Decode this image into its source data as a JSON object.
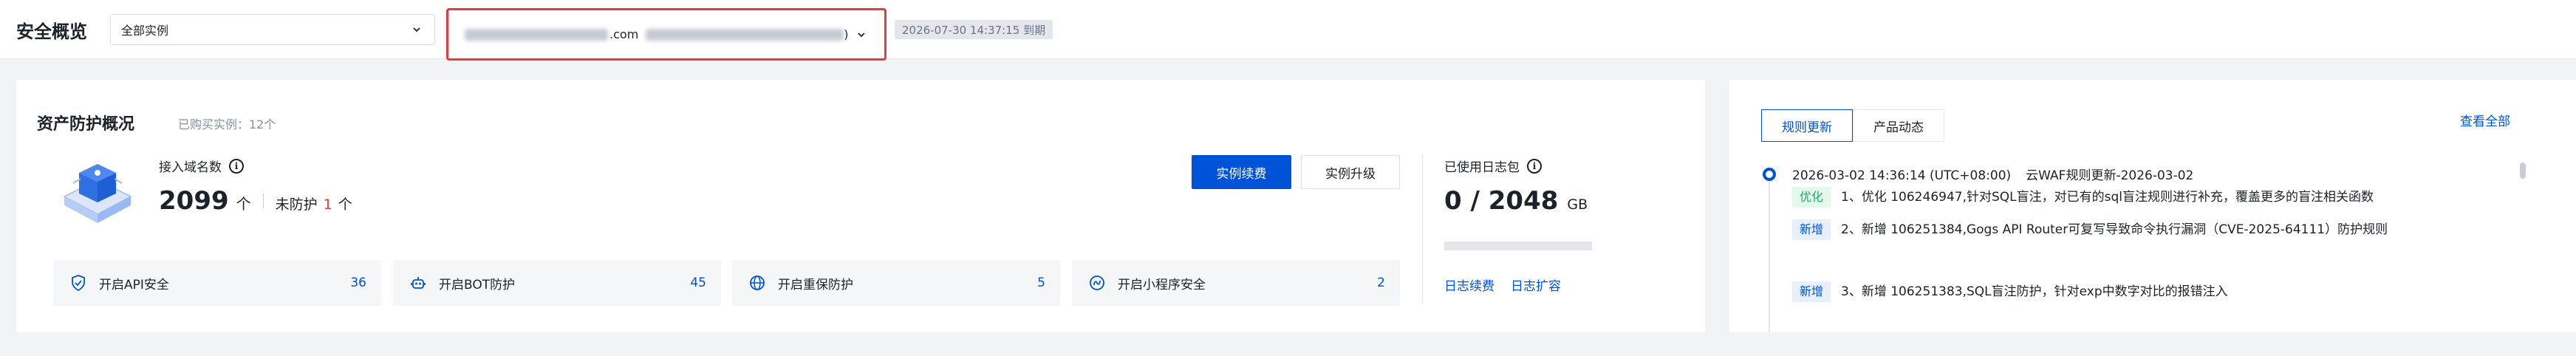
{
  "header": {
    "page_title": "安全概览",
    "instance_select": {
      "value": "全部实例"
    },
    "domain_select": {
      "value_suffix": ".com",
      "value_tail": ")"
    },
    "expiry": "2026-07-30 14:37:15 到期"
  },
  "overview": {
    "title": "资产防护概况",
    "subtitle": "已购买实例：12个",
    "domains": {
      "label": "接入域名数",
      "count": "2099",
      "unit": "个",
      "unprotected_label": "未防护",
      "unprotected_count": "1",
      "unprotected_unit": "个"
    },
    "buttons": {
      "renew": "实例续费",
      "upgrade": "实例升级"
    },
    "features": [
      {
        "label": "开启API安全",
        "count": "36",
        "icon": "shield-check-icon"
      },
      {
        "label": "开启BOT防护",
        "count": "45",
        "icon": "robot-icon"
      },
      {
        "label": "开启重保防护",
        "count": "5",
        "icon": "globe-icon"
      },
      {
        "label": "开启小程序安全",
        "count": "2",
        "icon": "mini-program-icon"
      }
    ],
    "logs": {
      "label": "已使用日志包",
      "value": "0 / 2048",
      "unit": "GB",
      "used_fraction": 0,
      "renew_link": "日志续费",
      "expand_link": "日志扩容"
    }
  },
  "updates": {
    "tabs": [
      {
        "label": "规则更新",
        "active": true
      },
      {
        "label": "产品动态",
        "active": false
      }
    ],
    "view_all": "查看全部",
    "entry": {
      "time": "2026-03-02 14:36:14 (UTC+08:00)",
      "title": "云WAF规则更新-2026-03-02",
      "items": [
        {
          "tag": "优化",
          "tag_type": "opt",
          "text": "1、优化 106246947,针对SQL盲注，对已有的sql盲注规则进行补充，覆盖更多的盲注相关函数"
        },
        {
          "tag": "新增",
          "tag_type": "new",
          "text": "2、新增 106251384,Gogs API Router可复写导致命令执行漏洞（CVE-2025-64111）防护规则"
        },
        {
          "tag": "新增",
          "tag_type": "new",
          "text": "3、新增 106251383,SQL盲注防护，针对exp中数字对比的报错注入"
        }
      ]
    }
  },
  "colors": {
    "accent": "#0052d9",
    "alert": "#e63c3c",
    "success": "#2ba471"
  }
}
